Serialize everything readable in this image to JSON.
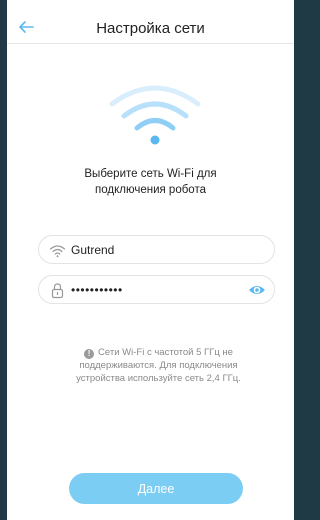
{
  "header": {
    "title": "Настройка сети"
  },
  "prompt": {
    "line1": "Выберите сеть Wi-Fi для",
    "line2": "подключения робота"
  },
  "ssid_field": {
    "value": "Gutrend"
  },
  "password_field": {
    "value": "•••••••••••"
  },
  "note": {
    "line1": "Сети Wi-Fi с частотой 5 ГГц не",
    "line2": "поддерживаются. Для подключения",
    "line3": "устройства используйте сеть 2,4 ГГц."
  },
  "next_button": {
    "label": "Далее"
  },
  "colors": {
    "accent": "#5bb8ee",
    "button": "#7ccdf3",
    "wifi_light": "#cfe9fb",
    "frame": "#1f3a44"
  },
  "icons": {
    "back": "arrow-left-icon",
    "hero": "wifi-signal-icon",
    "ssid": "wifi-icon",
    "password": "lock-icon",
    "eye": "eye-icon",
    "info": "info-icon"
  }
}
